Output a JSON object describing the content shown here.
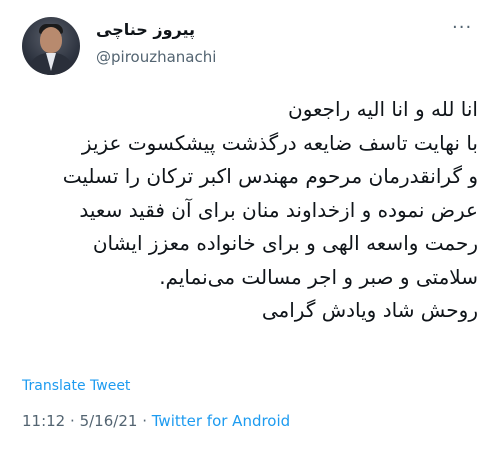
{
  "user": {
    "display_name": "پیروز حناچی",
    "handle": "@pirouzhanachi"
  },
  "more_icon": "more-dots-icon",
  "tweet_lines": [
    "انا لله و انا الیه راجعون",
    "با نهایت تاسف ضایعه درگذشت پیشکسوت عزیز",
    "و گرانقدرمان مرحوم مهندس اکبر ترکان را تسلیت",
    "عرض نموده و ازخداوند منان برای آن فقید سعید",
    "رحمت واسعه الهی و برای خانواده معزز ایشان",
    "سلامتی و صبر و اجر مسالت می‌نمایم.",
    "روحش شاد ویادش گرامی"
  ],
  "translate_label": "Translate Tweet",
  "meta": {
    "time": "11:12",
    "separator": "·",
    "date": "5/16/21",
    "source": "Twitter for Android"
  }
}
